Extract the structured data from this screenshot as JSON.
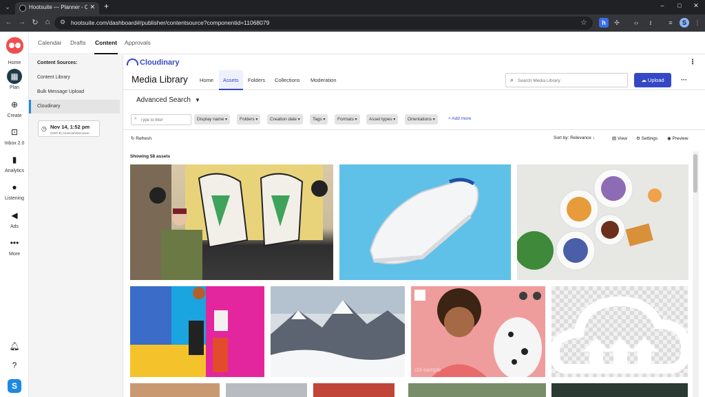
{
  "browser": {
    "tab_title": "Hootsuite — Planner - Content",
    "url": "hootsuite.com/dashboard#/publisher/contentsource?componentid=11068079",
    "tab_menu_icon": "chevron-down-icon",
    "new_tab": "+",
    "minimize": "–",
    "maximize": "□",
    "close": "✕",
    "tab_close": "✕",
    "profile_initial": "S"
  },
  "rail": {
    "items": [
      {
        "label": "Home",
        "icon": "owl-logo-icon"
      },
      {
        "label": "Plan",
        "icon": "calendar-icon"
      },
      {
        "label": "Create",
        "icon": "plus-circle-icon"
      },
      {
        "label": "Inbox 2.0",
        "icon": "inbox-icon"
      },
      {
        "label": "Analytics",
        "icon": "bar-chart-icon"
      },
      {
        "label": "Listening",
        "icon": "lightbulb-icon"
      },
      {
        "label": "Ads",
        "icon": "megaphone-icon"
      },
      {
        "label": "More",
        "icon": "more-dots-icon"
      }
    ]
  },
  "planner_tabs": [
    "Calendar",
    "Drafts",
    "Content",
    "Approvals"
  ],
  "sources": {
    "title": "Content Sources:",
    "items": [
      "Content Library",
      "Bulk Message Upload",
      "Cloudinary"
    ],
    "date": "Nov 14, 1:52 pm",
    "timezone": "(GMT-8) America/Vancouver"
  },
  "cloudinary": {
    "logo_text": "Cloudinary",
    "title": "Media Library",
    "tabs": [
      "Home",
      "Assets",
      "Folders",
      "Collections",
      "Moderation"
    ],
    "search_placeholder": "Search Media Library",
    "upload_label": "Upload",
    "advanced_search": "Advanced Search",
    "filter_placeholder": "Type to filter",
    "filters": [
      "Display name",
      "Folders",
      "Creation date",
      "Tags",
      "Formats",
      "Asset types",
      "Orientations"
    ],
    "add_more": "Add more",
    "refresh": "Refresh",
    "sort": "Sort by: Relevance",
    "view": "View",
    "settings": "Settings",
    "preview": "Preview",
    "showing": "Showing 58 assets",
    "watermark": "cld-sample"
  },
  "colors": {
    "accent": "#3448c5",
    "hootsuite_red": "#f04e4e",
    "plan_active": "#1d3b4a"
  }
}
